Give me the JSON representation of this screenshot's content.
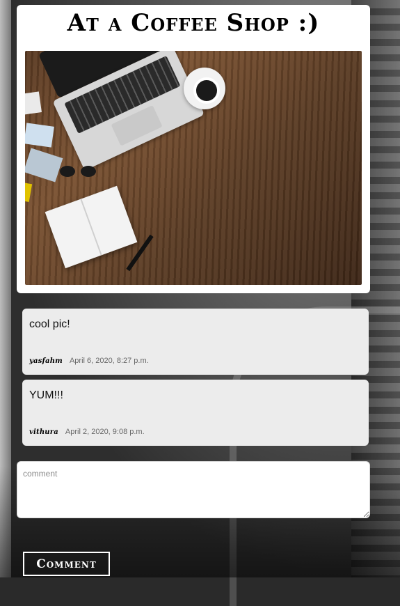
{
  "post": {
    "title": "At a Coffee Shop :)"
  },
  "comments": [
    {
      "text": "cool pic!",
      "author": "yasfahm",
      "date": "April 6, 2020, 8:27 p.m."
    },
    {
      "text": "YUM!!!",
      "author": "vithura",
      "date": "April 2, 2020, 9:08 p.m."
    }
  ],
  "comment_form": {
    "placeholder": "comment",
    "button_label": "Comment"
  }
}
